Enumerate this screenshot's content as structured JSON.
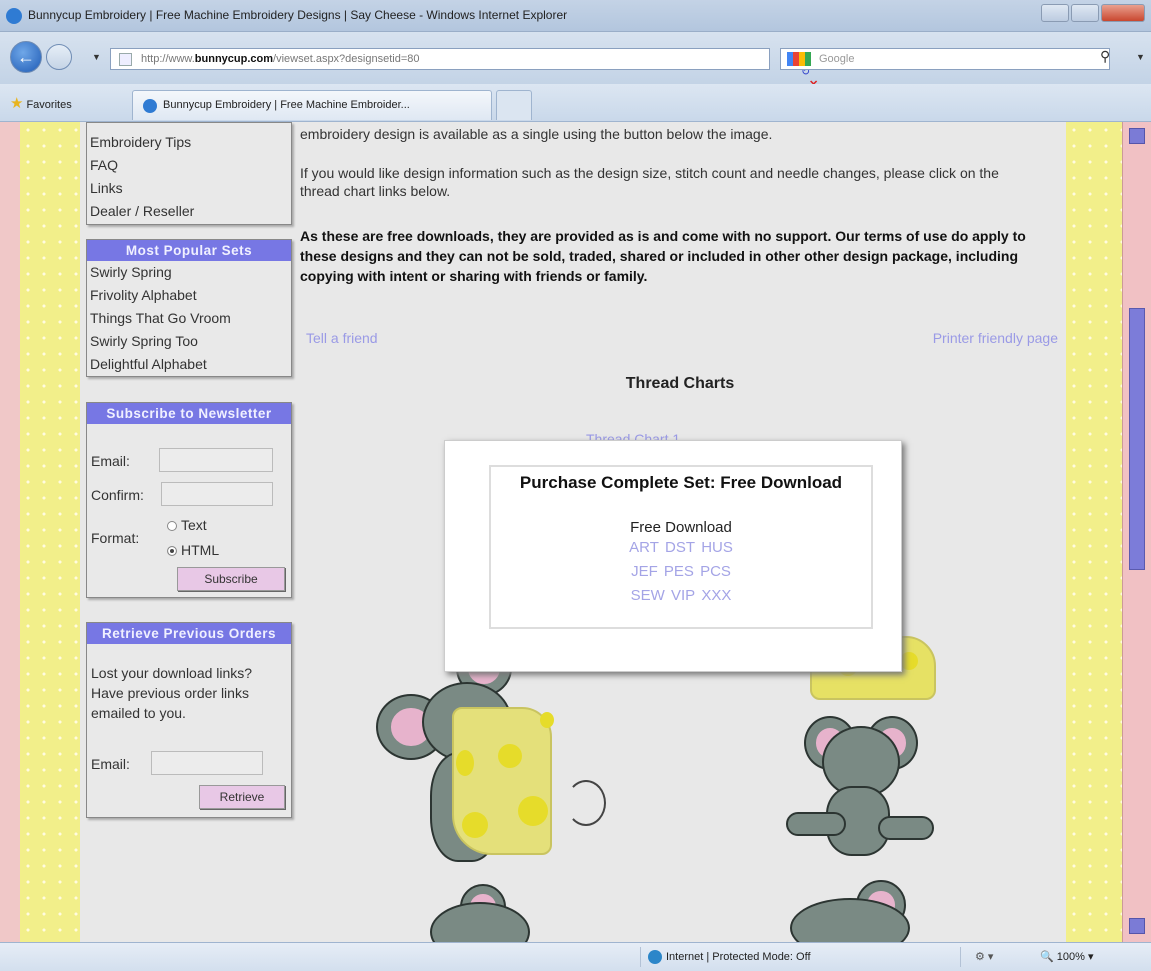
{
  "browser": {
    "window_title": "Bunnycup Embroidery | Free Machine Embroidery Designs | Say Cheese - Windows Internet Explorer",
    "url_prefix": "http://www.",
    "url_domain": "bunnycup.com",
    "url_rest": "/viewset.aspx?designsetid=80",
    "search_placeholder": "Google",
    "favorites_label": "Favorites",
    "tab_label": "Bunnycup Embroidery | Free Machine Embroider...",
    "status_zone": "Internet | Protected Mode: Off",
    "zoom": "100%"
  },
  "sidebar": {
    "nav_items": [
      "Embroidery Tips",
      "FAQ",
      "Links",
      "Dealer / Reseller"
    ],
    "popular": {
      "title": "Most Popular Sets",
      "items": [
        "Swirly Spring",
        "Frivolity Alphabet",
        "Things That Go Vroom",
        "Swirly Spring Too",
        "Delightful Alphabet"
      ]
    },
    "newsletter": {
      "title": "Subscribe to Newsletter",
      "email_label": "Email:",
      "confirm_label": "Confirm:",
      "format_label": "Format:",
      "opt_text": "Text",
      "opt_html": "HTML",
      "button": "Subscribe"
    },
    "retrieve": {
      "title": "Retrieve Previous Orders",
      "text": "Lost your download links? Have previous order links emailed to you.",
      "email_label": "Email:",
      "button": "Retrieve"
    }
  },
  "main": {
    "p1": "embroidery design is available as a single using the button below the image.",
    "p2": "If you would like design information such as the design size, stitch count and needle changes, please click on the thread chart links below.",
    "p3": "As these are free downloads, they are provided as is and come with no support. Our terms of use do apply to these designs and they can not be sold, traded, shared or included in other other design package, including copying with intent or sharing with friends or family.",
    "tell_friend": "Tell a friend",
    "printer_friendly": "Printer friendly page",
    "thread_charts_title": "Thread Charts",
    "thread_chart_1": "Thread Chart 1"
  },
  "popup": {
    "title": "Purchase Complete Set: Free Download",
    "subtitle": "Free Download",
    "formats": [
      [
        "ART",
        "DST",
        "HUS"
      ],
      [
        "JEF",
        "PES",
        "PCS"
      ],
      [
        "SEW",
        "VIP",
        "XXX"
      ]
    ]
  },
  "colors": {
    "accent_header": "#7777e4",
    "link": "#9a9ae6",
    "stripe": "#f2ef8a",
    "pink": "#f1c1c4"
  }
}
